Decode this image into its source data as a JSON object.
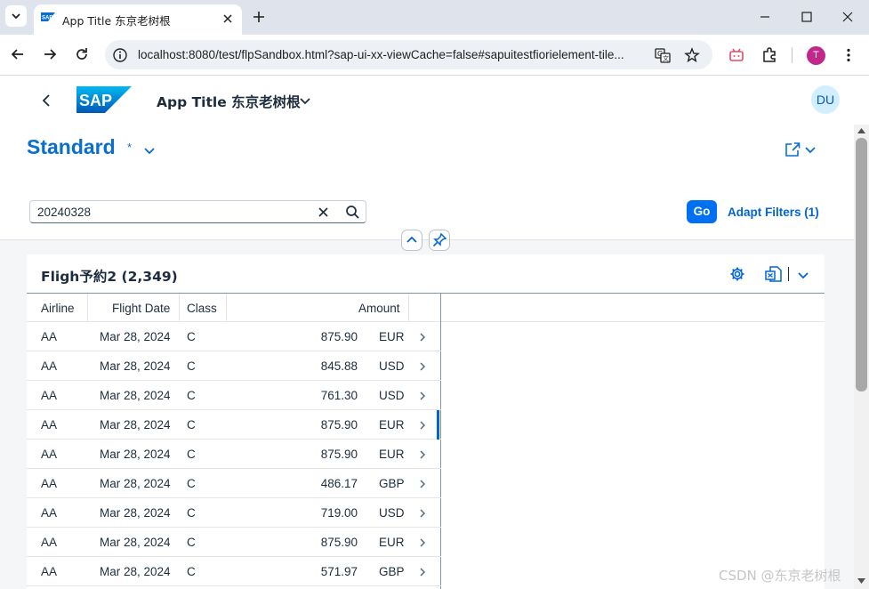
{
  "browser": {
    "tab_title": "App Title 东京老树根",
    "url": "localhost:8080/test/flpSandbox.html?sap-ui-xx-viewCache=false#sapuitestfiorielement-tile...",
    "profile_initial": "T"
  },
  "shell": {
    "logo_text": "SAP",
    "app_title": "App Title 东京老树根",
    "user_initials": "DU"
  },
  "header": {
    "variant_name": "Standard",
    "variant_modified": "*",
    "search_value": "20240328",
    "go_label": "Go",
    "adapt_filters_label": "Adapt Filters (1)"
  },
  "table": {
    "title": "Fligh予約2 (2,349)",
    "columns": [
      "Airline",
      "Flight Date",
      "Class",
      "Amount"
    ],
    "rows": [
      {
        "airline": "AA",
        "date": "Mar 28, 2024",
        "class": "C",
        "amount": "875.90",
        "currency": "EUR"
      },
      {
        "airline": "AA",
        "date": "Mar 28, 2024",
        "class": "C",
        "amount": "845.88",
        "currency": "USD"
      },
      {
        "airline": "AA",
        "date": "Mar 28, 2024",
        "class": "C",
        "amount": "761.30",
        "currency": "USD"
      },
      {
        "airline": "AA",
        "date": "Mar 28, 2024",
        "class": "C",
        "amount": "875.90",
        "currency": "EUR"
      },
      {
        "airline": "AA",
        "date": "Mar 28, 2024",
        "class": "C",
        "amount": "875.90",
        "currency": "EUR"
      },
      {
        "airline": "AA",
        "date": "Mar 28, 2024",
        "class": "C",
        "amount": "486.17",
        "currency": "GBP"
      },
      {
        "airline": "AA",
        "date": "Mar 28, 2024",
        "class": "C",
        "amount": "719.00",
        "currency": "USD"
      },
      {
        "airline": "AA",
        "date": "Mar 28, 2024",
        "class": "C",
        "amount": "875.90",
        "currency": "EUR"
      },
      {
        "airline": "AA",
        "date": "Mar 28, 2024",
        "class": "C",
        "amount": "571.97",
        "currency": "GBP"
      }
    ],
    "selected_row_index": 3
  },
  "watermark": "CSDN @东京老树根",
  "colors": {
    "accent": "#0a6ed1",
    "go_button": "#0070f2",
    "link": "#0064d9",
    "tabstrip": "#dfe3eb"
  }
}
